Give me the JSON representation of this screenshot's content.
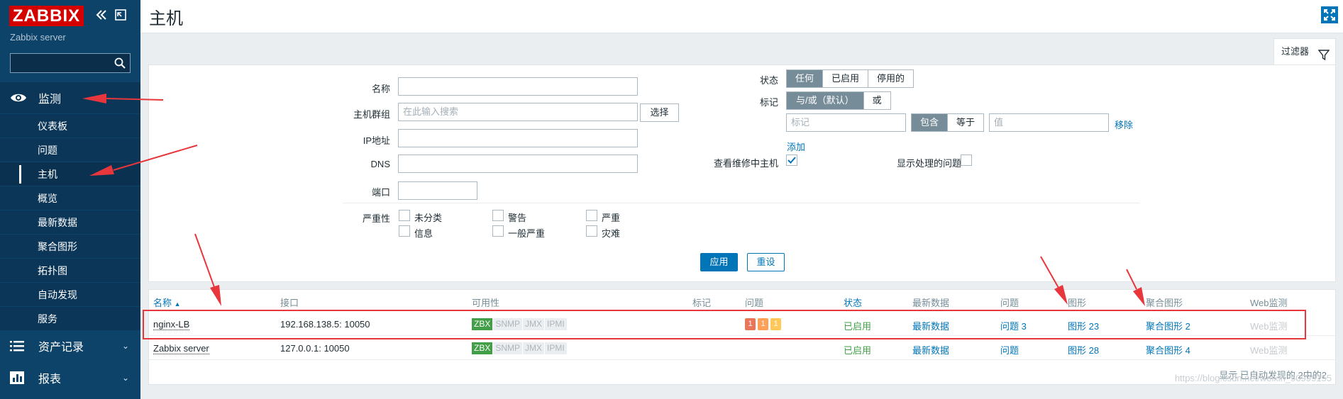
{
  "app": {
    "logo": "ZABBIX",
    "server_name": "Zabbix server",
    "page_title": "主机"
  },
  "sidebar": {
    "collapse_icon": "double-chevron-left-icon",
    "kiosk_icon": "kiosk-mode-icon",
    "search_value": "",
    "monitoring_label": "监测",
    "inventory_label": "资产记录",
    "reports_label": "报表",
    "submenu": [
      {
        "label": "仪表板"
      },
      {
        "label": "问题"
      },
      {
        "label": "主机"
      },
      {
        "label": "概览"
      },
      {
        "label": "最新数据"
      },
      {
        "label": "聚合图形"
      },
      {
        "label": "拓扑图"
      },
      {
        "label": "自动发现"
      },
      {
        "label": "服务"
      }
    ]
  },
  "filter": {
    "tab_label": "过滤器",
    "name_label": "名称",
    "name_value": "",
    "hostgroup_label": "主机群组",
    "hostgroup_placeholder": "在此输入搜索",
    "select_button": "选择",
    "ip_label": "IP地址",
    "dns_label": "DNS",
    "port_label": "端口",
    "severity_label": "严重性",
    "severities": [
      "未分类",
      "信息",
      "警告",
      "一般严重",
      "严重",
      "灾难"
    ],
    "status_label": "状态",
    "status_options": [
      "任何",
      "已启用",
      "停用的"
    ],
    "status_selected": "任何",
    "tags_label": "标记",
    "tag_operator_options": [
      "与/或（默认）",
      "或"
    ],
    "tag_operator_selected": "与/或（默认）",
    "tag_name_placeholder": "标记",
    "tag_condition_options": [
      "包含",
      "等于"
    ],
    "tag_condition_selected": "包含",
    "tag_value_placeholder": "值",
    "remove_link": "移除",
    "add_link": "添加",
    "maintenance_label": "查看维修中主机",
    "maintenance_checked": true,
    "suppressed_label": "显示处理的问题",
    "suppressed_checked": false,
    "apply_button": "应用",
    "reset_button": "重设"
  },
  "table": {
    "headers": {
      "name": "名称",
      "interface": "接口",
      "availability": "可用性",
      "tags": "标记",
      "problems": "问题",
      "status": "状态",
      "latest": "最新数据",
      "problems_link": "问题",
      "graphs": "图形",
      "screens": "聚合图形",
      "web": "Web监测"
    },
    "rows": [
      {
        "name": "nginx-LB",
        "interface": "192.168.138.5: 10050",
        "availability": [
          "ZBX",
          "SNMP",
          "JMX",
          "IPMI"
        ],
        "problems": [
          {
            "count": "1",
            "color": "#e97659"
          },
          {
            "count": "1",
            "color": "#ffa059"
          },
          {
            "count": "1",
            "color": "#ffc859"
          }
        ],
        "status": "已启用",
        "latest": "最新数据",
        "problems_link": "问题 3",
        "graphs": "图形 23",
        "screens": "聚合图形 2",
        "web": "Web监测"
      },
      {
        "name": "Zabbix server",
        "interface": "127.0.0.1: 10050",
        "availability": [
          "ZBX",
          "SNMP",
          "JMX",
          "IPMI"
        ],
        "problems": [],
        "status": "已启用",
        "latest": "最新数据",
        "problems_link": "问题",
        "graphs": "图形 28",
        "screens": "聚合图形 4",
        "web": "Web监测"
      }
    ],
    "footer": "显示 已自动发现的 2中的2"
  },
  "watermark": "https://blog.csdn.net/weixin_50999155"
}
